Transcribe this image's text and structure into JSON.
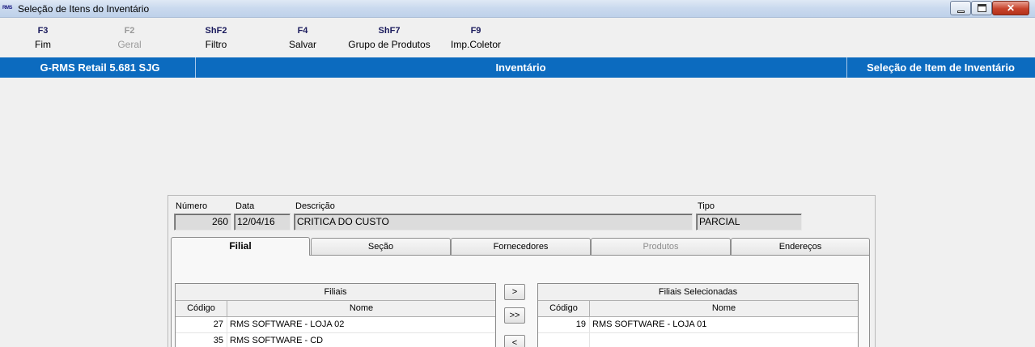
{
  "window": {
    "title": "Seleção de Itens do Inventário",
    "icon_text": "RMS",
    "controls": {
      "minimize": "minimize-icon",
      "maximize": "maximize-icon",
      "close": "close-icon",
      "close_glyph": "✕"
    }
  },
  "toolbar": {
    "items": [
      {
        "key": "F3",
        "label": "Fim",
        "enabled": true
      },
      {
        "key": "F2",
        "label": "Geral",
        "enabled": false
      },
      {
        "key": "ShF2",
        "label": "Filtro",
        "enabled": true
      },
      {
        "key": "F4",
        "label": "Salvar",
        "enabled": true
      },
      {
        "key": "ShF7",
        "label": "Grupo de Produtos",
        "enabled": true
      },
      {
        "key": "F9",
        "label": "Imp.Coletor",
        "enabled": true
      }
    ]
  },
  "banner": {
    "left": "G-RMS Retail 5.681 SJG",
    "center": "Inventário",
    "right": "Seleção de Item de Inventário",
    "color": "#0c6bbf"
  },
  "form": {
    "numero": {
      "label": "Número",
      "value": "260"
    },
    "data": {
      "label": "Data",
      "value": "12/04/16"
    },
    "descricao": {
      "label": "Descrição",
      "value": "CRITICA DO CUSTO"
    },
    "tipo": {
      "label": "Tipo",
      "value": "PARCIAL"
    }
  },
  "tabs": [
    {
      "label": "Filial",
      "active": true,
      "enabled": true
    },
    {
      "label": "Seção",
      "active": false,
      "enabled": true
    },
    {
      "label": "Fornecedores",
      "active": false,
      "enabled": true
    },
    {
      "label": "Produtos",
      "active": false,
      "enabled": false
    },
    {
      "label": "Endereços",
      "active": false,
      "enabled": true
    }
  ],
  "filiais": {
    "caption": "Filiais",
    "columns": [
      "Código",
      "Nome"
    ],
    "rows": [
      {
        "codigo": "27",
        "nome": "RMS SOFTWARE - LOJA 02"
      },
      {
        "codigo": "35",
        "nome": "RMS SOFTWARE - CD"
      }
    ]
  },
  "filiais_selecionadas": {
    "caption": "Filiais Selecionadas",
    "columns": [
      "Código",
      "Nome"
    ],
    "rows": [
      {
        "codigo": "19",
        "nome": "RMS SOFTWARE - LOJA 01"
      }
    ]
  },
  "move_buttons": {
    "add_one": ">",
    "add_all": ">>",
    "remove_one": "<"
  }
}
